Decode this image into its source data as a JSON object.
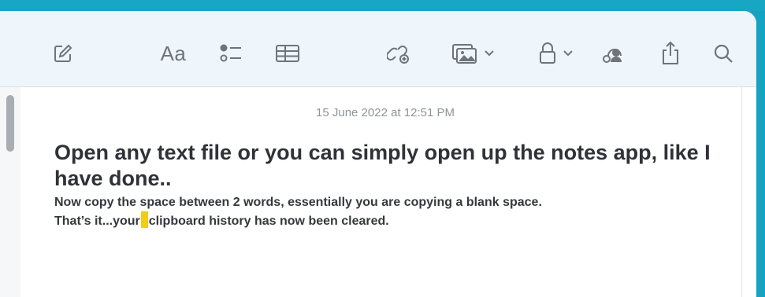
{
  "toolbar": {
    "buttons": [
      {
        "name": "new-note",
        "icon": "compose-icon"
      },
      {
        "name": "format",
        "icon": "format-aa-icon",
        "label": "Aa"
      },
      {
        "name": "checklist",
        "icon": "checklist-icon"
      },
      {
        "name": "table",
        "icon": "table-icon"
      },
      {
        "name": "link",
        "icon": "link-icon"
      },
      {
        "name": "media",
        "icon": "photo-icon"
      },
      {
        "name": "lock",
        "icon": "lock-icon"
      },
      {
        "name": "collaborate",
        "icon": "collaborate-icon"
      },
      {
        "name": "share",
        "icon": "share-icon"
      },
      {
        "name": "search",
        "icon": "search-icon"
      }
    ]
  },
  "note": {
    "date": "15 June 2022 at 12:51 PM",
    "title": "Open any text file or you can simply open up the notes app, like I have done..",
    "body_line1": "Now copy the space between 2 words, essentially you are copying a blank space.",
    "body_line2_before": "That’s it...your",
    "body_line2_after": "clipboard history has now been cleared."
  },
  "colors": {
    "desktop": "#16a3c2",
    "toolbar": "#eef5fb",
    "icon": "#6f7478",
    "highlight": "#f3cc16"
  }
}
